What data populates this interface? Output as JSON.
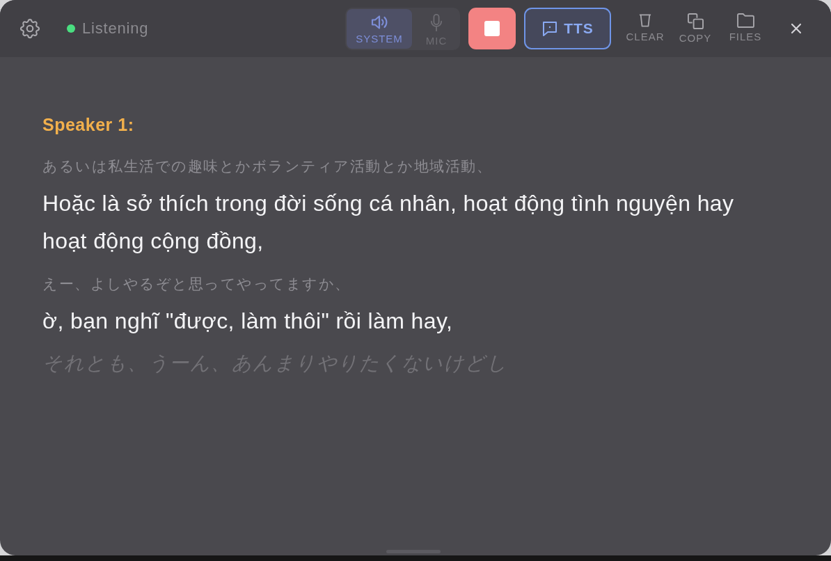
{
  "header": {
    "status": {
      "label": "Listening",
      "active": true
    },
    "sources": [
      {
        "label": "SYSTEM",
        "kind": "speaker",
        "selected": true
      },
      {
        "label": "MIC",
        "kind": "mic",
        "selected": false
      }
    ],
    "record_button": {
      "recording": true
    },
    "tts_button": {
      "label": "TTS",
      "on": true
    },
    "actions": [
      {
        "label": "CLEAR",
        "kind": "trash"
      },
      {
        "label": "COPY",
        "kind": "copy"
      },
      {
        "label": "FILES",
        "kind": "folder"
      }
    ]
  },
  "transcript": {
    "speaker": "Speaker 1:",
    "lines": [
      {
        "kind": "source",
        "text": "あるいは私生活での趣味とかボランティア活動とか地域活動、"
      },
      {
        "kind": "translation",
        "text": "Hoặc là sở thích trong đời sống cá nhân, hoạt động tình nguyện hay hoạt động cộng đồng,"
      },
      {
        "kind": "source",
        "text": "えー、よしやるぞと思ってやってますか、"
      },
      {
        "kind": "translation",
        "text": "ờ, bạn nghĩ \"được, làm thôi\" rồi làm hay,"
      },
      {
        "kind": "interim",
        "text": "それとも、うーん、あんまりやりたくないけどし"
      }
    ]
  }
}
